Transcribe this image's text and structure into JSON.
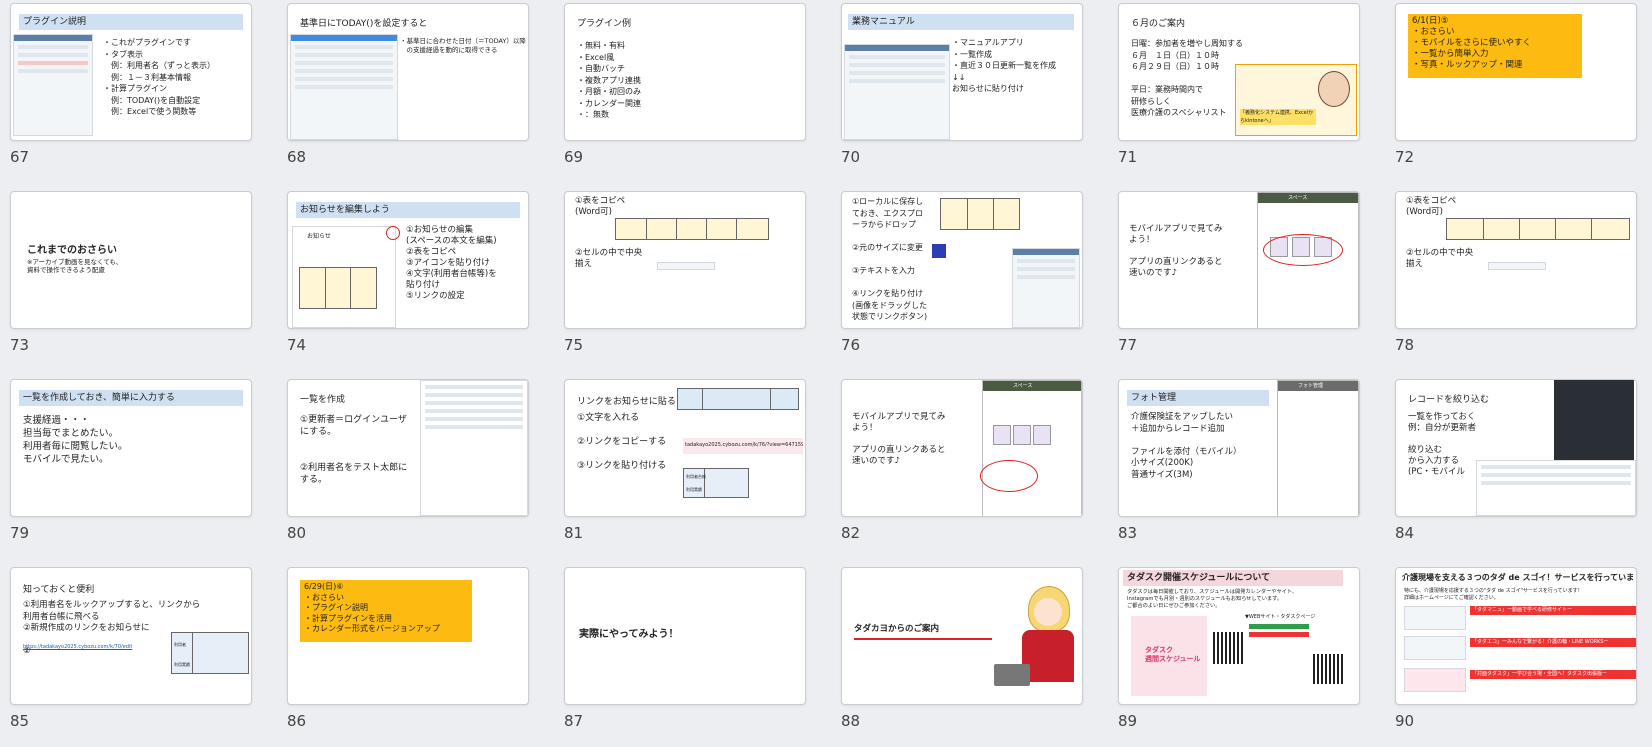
{
  "slides": [
    {
      "number": "67",
      "header": "プラグイン説明",
      "lines": "・これがプラグインです\n・タブ表示\n　例：利用者名（ずっと表示）\n　例：１－３利基本情報\n・計算プラグイン\n　例：TODAY()を自動設定\n　例：Excelで使う関数等"
    },
    {
      "number": "68",
      "title": "基準日にTODAY()を設定すると",
      "lines": "・基準日に合わせた日付（＝TODAY）以降\n　の支援経過を動的に取得できる"
    },
    {
      "number": "69",
      "title": "プラグイン例",
      "lines": "・無料・有料\n・Excel風\n・自動バッチ\n・複数アプリ連携\n・月額・初回のみ\n・カレンダー関連\n・：無数"
    },
    {
      "number": "70",
      "header": "業務マニュアル",
      "lines": "・マニュアルアプリ\n・一覧作成\n・直近３０日更新一覧を作成\n↓↓\nお知らせに貼り付け"
    },
    {
      "number": "71",
      "title": "６月のご案内",
      "lines": "日曜：参加者を増やし周知する\n６月　１日（日）１０時\n６月２９日（日）１０時\n\n平日：業務時間内で\n研修らしく\n医療介護のスペシャリスト",
      "flyer": "「義務化システム連携、Excelからkintoneへ」"
    },
    {
      "number": "72",
      "box_text": "6/1(日)⑤\n・おさらい\n・モバイルをさらに使いやすく\n・一覧から簡単入力\n・写真・ルックアップ・関連"
    },
    {
      "number": "73",
      "title": "これまでのおさらい",
      "sub": "※アーカイブ動画を見なくても、\n資料で操作できるよう配慮"
    },
    {
      "number": "74",
      "header": "お知らせを編集しよう",
      "lines": "①お知らせの編集\n(スペースの本文を編集)\n②表をコピペ\n③アイコンを貼り付け\n④文字(利用者台帳等)を\n貼り付け\n⑤リンクの設定",
      "panel": "お知らせ"
    },
    {
      "number": "75",
      "lines_a": "①表をコピペ\n(Word可)",
      "lines_b": "②セルの中で中央\n揃え"
    },
    {
      "number": "76",
      "lines": "①ローカルに保存し\nておき、エクスプロ\nーラからドロップ\n\n②元のサイズに変更\n\n③テキストを入力\n\n④リンクを貼り付け\n(画像をドラッグした\n状態でリンクボタン)"
    },
    {
      "number": "77",
      "lines": "モバイルアプリで見てみ\nよう！\n\nアプリの直リンクあると\n速いのです♪",
      "phone_title": "スペース"
    },
    {
      "number": "78",
      "lines_a": "①表をコピペ\n(Word可)",
      "lines_b": "②セルの中で中央\n揃え"
    },
    {
      "number": "79",
      "header": "一覧を作成しておき、簡単に入力する",
      "lines": "支援経過・・・\n担当毎でまとめたい。\n利用者毎に閲覧したい。\nモバイルで見たい。"
    },
    {
      "number": "80",
      "title": "一覧を作成",
      "lines": "①更新者＝ログインユーザ\nにする。\n\n\n②利用者名をテスト太郎に\nする。"
    },
    {
      "number": "81",
      "title": "リンクをお知らせに貼る",
      "lines": "①文字を入れる\n\n②リンクをコピーする\n\n③リンクを貼り付ける",
      "url": "tadakayo2025.cybozu.com/k/76/?view=6471599",
      "tbl_a": "利用者台帳",
      "tbl_b": "利用実績"
    },
    {
      "number": "82",
      "lines": "モバイルアプリで見てみ\nよう！\n\nアプリの直リンクあると\n速いのです♪",
      "phone_title": "スペース"
    },
    {
      "number": "83",
      "header": "フォト管理",
      "lines": "介護保険証をアップしたい\n＋追加からレコード追加\n\nファイルを添付（モバイル）\n小サイズ(200K)\n普通サイズ(3M)",
      "phone_title": "フォト管理"
    },
    {
      "number": "84",
      "title": "レコードを絞り込む",
      "lines": "一覧を作っておく\n例：自分が更新者\n\n絞り込む\nから入力する\n(PC・モバイル"
    },
    {
      "number": "85",
      "title": "知っておくと便利",
      "lines": "①利用者名をルックアップすると、リンクから\n利用者台帳に飛べる\n②新規作成のリンクをお知らせに\n\n②",
      "url": "https://tadakayo2025.cybozu.com/k/70/edit",
      "tbl_a": "利用者",
      "tbl_b": "利用実績"
    },
    {
      "number": "86",
      "box_text": "6/29(日)⑥\n・おさらい\n・プラグイン説明\n・計算プラグインを活用\n・カレンダー形式をバージョンアップ"
    },
    {
      "number": "87",
      "title": "実際にやってみよう！"
    },
    {
      "number": "88",
      "title": "タダカヨからのご案内"
    },
    {
      "number": "89",
      "header": "タダスク開催スケジュールについて",
      "lines": "タダスクは毎日開催しており、スケジュールは開発カレンダーやサイト、\nInstagramでも月別・週別のスケジュールもお知らせしています。\nご都合のよい日にぜひご参加ください。",
      "poster": "タダスク\n週間スケジュール",
      "web": "▼WEBサイト・タダスクページ"
    },
    {
      "number": "90",
      "header": "介護現場を支える３つのタダ de スゴイ！サービスを行っています！",
      "lines": "特にも、介護現場を応援する３つの\"タダ de スゴイ\"サービスを行っています！\n詳細はホームページにてご確認ください。",
      "b1": "「タダマニュ」一動画で学べる研修サイトー",
      "b2": "「タダエコ」一みんなで繋がる！介護の輪・LINE WORKSー",
      "b3": "「対面タダスク」一学び合う場・全国へ！タダスク出張版ー"
    }
  ]
}
